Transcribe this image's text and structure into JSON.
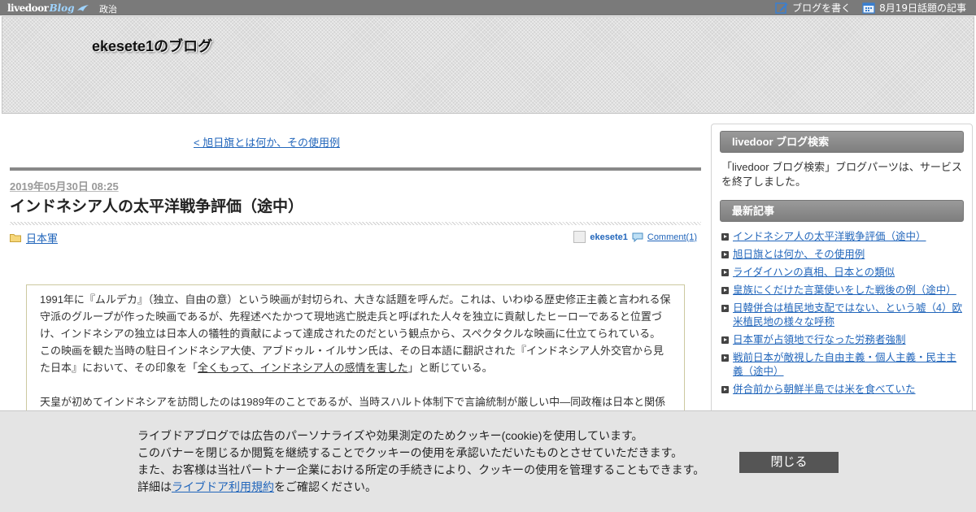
{
  "topbar": {
    "logo_text": "livedoor",
    "logo_blog": "Blog",
    "category": "政治",
    "write_blog": "ブログを書く",
    "topic": "8月19日話題の記事"
  },
  "header": {
    "blog_title": "ekesete1のブログ"
  },
  "article": {
    "prev_link": "< 旭日旗とは何か、その使用例",
    "date": "2019年05月30日 08:25",
    "title": "インドネシア人の太平洋戦争評価（途中）",
    "category": "日本軍",
    "author": "ekesete1",
    "comments": "Comment(1)",
    "para1_a": "1991年に『ムルデカ』（独立、自由の意）という映画が封切られ、大きな話題を呼んだ。これは、いわゆる歴史修正主義と言われる保守派のグループが作った映画であるが、先程述べたかつて現地逃亡脱走兵と呼ばれた人々を独立に貢献したヒーローであると位置づけ、インドネシアの独立は日本人の犠牲的貢献によって達成されたのだという観点から、スペクタクルな映画に仕立てられている。この映画を観た当時の駐日インドネシア大使、アブドゥル・イルサン氏は、その日本語に翻訳された『インドネシア人外交官から見た日本』において、その印象を「",
    "para1_link": "全くもって、インドネシア人の感情を害した",
    "para1_b": "」と断じている。",
    "para2": "天皇が初めてインドネシアを訪問したのは1989年のことであるが、当時スハルト体制下で言論統制が厳しい中―同政権は日本と関係"
  },
  "sidebar": {
    "search_heading": "livedoor ブログ検索",
    "search_notice": "「livedoor ブログ検索」ブログパーツは、サービスを終了しました。",
    "recent_heading": "最新記事",
    "recent": [
      "インドネシア人の太平洋戦争評価（途中）",
      "旭日旗とは何か、その使用例",
      "ライダイハンの真相、日本との類似",
      "皇族にくだけた言葉使いをした戦後の例（途中）",
      "日韓併合は植民地支配ではない、という嘘（4）欧米植民地の様々な呼称",
      "日本軍が占領地で行なった労務者強制",
      "戦前日本が敵視した自由主義・個人主義・民主主義（途中）",
      "併合前から朝鮮半島では米を食べていた"
    ]
  },
  "cookie": {
    "line1": "ライブドアブログでは広告のパーソナライズや効果測定のためクッキー(cookie)を使用しています。",
    "line2": "このバナーを閉じるか閲覧を継続することでクッキーの使用を承認いただいたものとさせていただきます。",
    "line3": "また、お客様は当社パートナー企業における所定の手続きにより、クッキーの使用を管理することもできます。",
    "line4_pre": "詳細は",
    "line4_link": "ライブドア利用規約",
    "line4_post": "をご確認ください。",
    "close": "閉じる"
  }
}
